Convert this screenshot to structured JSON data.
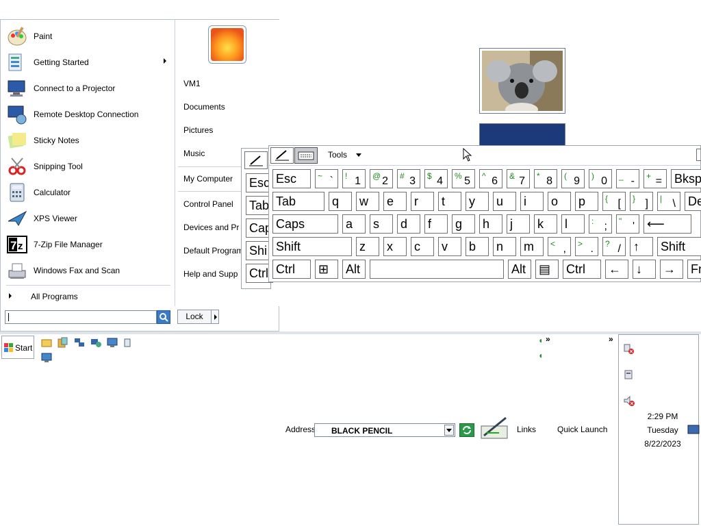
{
  "start_menu": {
    "programs": [
      {
        "label": "Paint",
        "icon": "paint-icon"
      },
      {
        "label": "Getting Started",
        "icon": "getting-started-icon",
        "submenu": true
      },
      {
        "label": "Connect to a Projector",
        "icon": "projector-icon"
      },
      {
        "label": "Remote Desktop Connection",
        "icon": "remote-desktop-icon"
      },
      {
        "label": "Sticky Notes",
        "icon": "sticky-notes-icon"
      },
      {
        "label": "Snipping Tool",
        "icon": "snipping-tool-icon"
      },
      {
        "label": "Calculator",
        "icon": "calculator-icon"
      },
      {
        "label": "XPS Viewer",
        "icon": "xps-viewer-icon"
      },
      {
        "label": "7-Zip File Manager",
        "icon": "7zip-icon"
      },
      {
        "label": "Windows Fax and Scan",
        "icon": "fax-scan-icon"
      }
    ],
    "all_programs": "All Programs",
    "search_placeholder": "",
    "lock_label": "Lock",
    "right_items": [
      "VM1",
      "Documents",
      "Pictures",
      "Music",
      "My Computer",
      "Control Panel",
      "Devices and Pr",
      "Default Program",
      "Help and Supp"
    ]
  },
  "osk": {
    "tools_label": "Tools",
    "side_keys": [
      "Esc",
      "Tab",
      "Cap",
      "Shi",
      "Ctrl"
    ],
    "rows": [
      [
        {
          "m": "Esc"
        },
        {
          "s": "~",
          "m": "`"
        },
        {
          "s": "!",
          "m": "1"
        },
        {
          "s": "@",
          "m": "2"
        },
        {
          "s": "#",
          "m": "3"
        },
        {
          "s": "$",
          "m": "4"
        },
        {
          "s": "%",
          "m": "5"
        },
        {
          "s": "^",
          "m": "6"
        },
        {
          "s": "&",
          "m": "7"
        },
        {
          "s": "*",
          "m": "8"
        },
        {
          "s": "(",
          "m": "9"
        },
        {
          "s": ")",
          "m": "0"
        },
        {
          "s": "_",
          "m": "-"
        },
        {
          "s": "+",
          "m": "="
        },
        {
          "m": "Bksp"
        }
      ],
      [
        {
          "m": "Tab"
        },
        {
          "m": "q"
        },
        {
          "m": "w"
        },
        {
          "m": "e"
        },
        {
          "m": "r"
        },
        {
          "m": "t"
        },
        {
          "m": "y"
        },
        {
          "m": "u"
        },
        {
          "m": "i"
        },
        {
          "m": "o"
        },
        {
          "m": "p"
        },
        {
          "s": "{",
          "m": "["
        },
        {
          "s": "}",
          "m": "]"
        },
        {
          "s": "|",
          "m": "\\"
        },
        {
          "m": "De"
        }
      ],
      [
        {
          "m": "Caps"
        },
        {
          "m": "a"
        },
        {
          "m": "s"
        },
        {
          "m": "d"
        },
        {
          "m": "f"
        },
        {
          "m": "g"
        },
        {
          "m": "h"
        },
        {
          "m": "j"
        },
        {
          "m": "k"
        },
        {
          "m": "l"
        },
        {
          "s": ":",
          "m": ";"
        },
        {
          "s": "\"",
          "m": "'"
        },
        {
          "m": "⟵"
        }
      ],
      [
        {
          "m": "Shift"
        },
        {
          "m": "z"
        },
        {
          "m": "x"
        },
        {
          "m": "c"
        },
        {
          "m": "v"
        },
        {
          "m": "b"
        },
        {
          "m": "n"
        },
        {
          "m": "m"
        },
        {
          "s": "<",
          "m": ","
        },
        {
          "s": ">",
          "m": "."
        },
        {
          "s": "?",
          "m": "/"
        },
        {
          "m": "↑"
        },
        {
          "m": "Shift"
        }
      ],
      [
        {
          "m": "Ctrl"
        },
        {
          "m": "⊞"
        },
        {
          "m": "Alt"
        },
        {
          "m": ""
        },
        {
          "m": "Alt"
        },
        {
          "m": "▤"
        },
        {
          "m": "Ctrl"
        },
        {
          "m": "←"
        },
        {
          "m": "↓"
        },
        {
          "m": "→"
        },
        {
          "m": "Fn"
        }
      ]
    ]
  },
  "taskbar": {
    "start_label": "Start",
    "address_label": "Address",
    "address_value": "BLACK PENCIL",
    "links_label": "Links",
    "quick_launch_label": "Quick Launch",
    "chevron": "»",
    "time": "2:29 PM",
    "day": "Tuesday",
    "date": "8/22/2023"
  }
}
